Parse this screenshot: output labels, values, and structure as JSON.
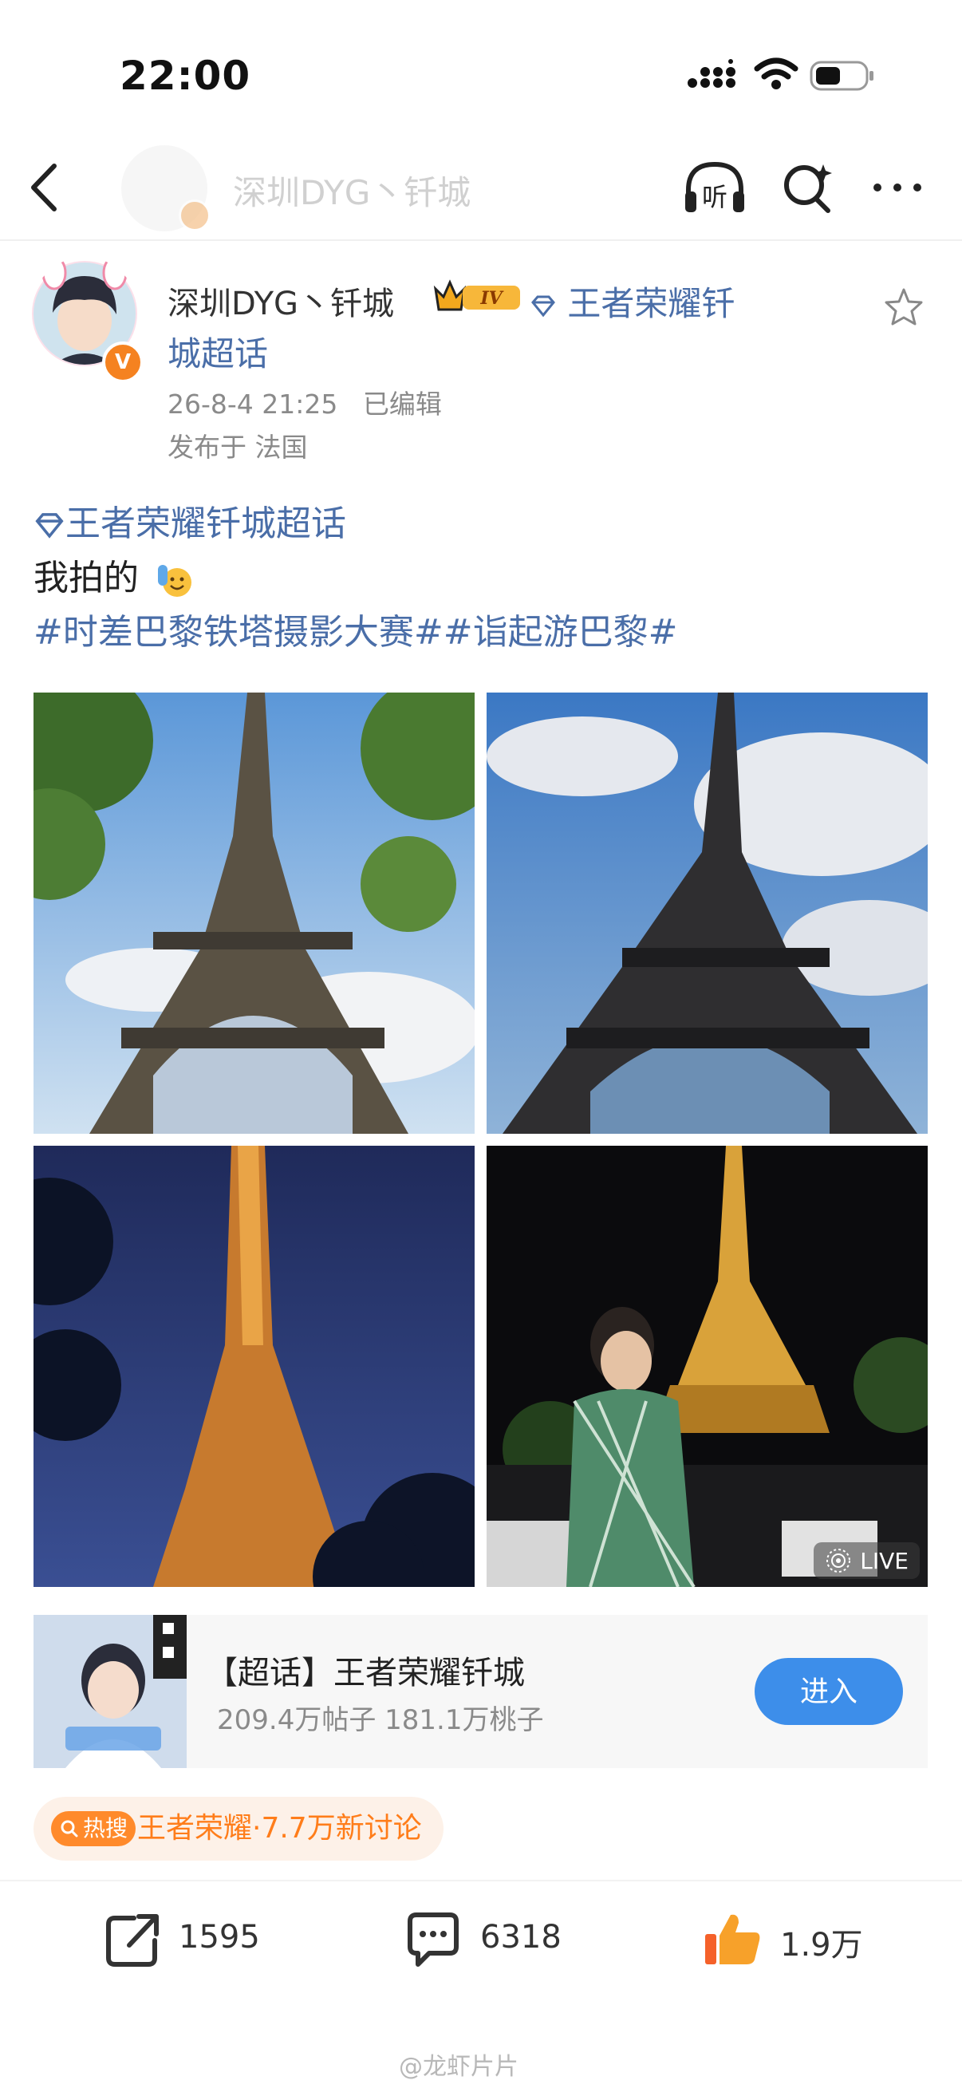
{
  "status_bar": {
    "time": "22:00"
  },
  "nav": {
    "title": "深圳DYG丶钎城",
    "listen_label": "听"
  },
  "post": {
    "author": "深圳DYG丶钎城",
    "level_badge": "IV",
    "topic_link_line1": "王者荣耀钎",
    "topic_link_line2": "城超话",
    "timestamp": "26-8-4 21:25",
    "edited": "已编辑",
    "location": "发布于 法国",
    "body_topic": "王者荣耀钎城超话",
    "body_text": "我拍的",
    "body_hashtags": "#时差巴黎铁塔摄影大赛##诣起游巴黎#",
    "live_label": "LIVE"
  },
  "card": {
    "title": "【超话】王者荣耀钎城",
    "stats": "209.4万帖子 181.1万桃子",
    "enter_label": "进入"
  },
  "hot_search": {
    "tag": "热搜",
    "text": "王者荣耀·7.7万新讨论"
  },
  "actions": {
    "reposts": "1595",
    "comments": "6318",
    "likes": "1.9万"
  },
  "watermark": "@龙虾片片",
  "colors": {
    "link": "#4a6ea8",
    "accent": "#ff7d1a",
    "button": "#3d8eea"
  }
}
